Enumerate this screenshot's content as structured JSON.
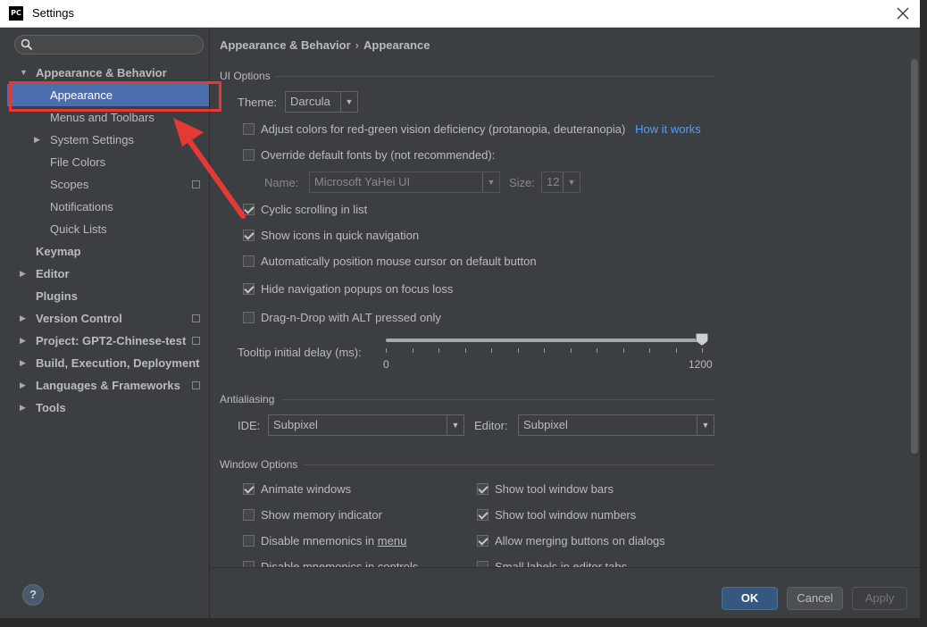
{
  "window": {
    "title": "Settings",
    "app_icon": "PC"
  },
  "search": {
    "placeholder": ""
  },
  "sidebar": {
    "items": [
      {
        "label": "Appearance & Behavior",
        "arrow": "▼"
      },
      {
        "label": "Appearance"
      },
      {
        "label": "Menus and Toolbars"
      },
      {
        "label": "System Settings",
        "arrow": "▶"
      },
      {
        "label": "File Colors"
      },
      {
        "label": "Scopes"
      },
      {
        "label": "Notifications"
      },
      {
        "label": "Quick Lists"
      },
      {
        "label": "Keymap"
      },
      {
        "label": "Editor",
        "arrow": "▶"
      },
      {
        "label": "Plugins"
      },
      {
        "label": "Version Control",
        "arrow": "▶"
      },
      {
        "label": "Project: GPT2-Chinese-test",
        "arrow": "▶"
      },
      {
        "label": "Build, Execution, Deployment",
        "arrow": "▶"
      },
      {
        "label": "Languages & Frameworks",
        "arrow": "▶"
      },
      {
        "label": "Tools",
        "arrow": "▶"
      }
    ],
    "help_label": "?"
  },
  "breadcrumb": {
    "parent": "Appearance & Behavior",
    "separator": "›",
    "current": "Appearance"
  },
  "ui_options": {
    "title": "UI Options",
    "theme_label": "Theme:",
    "theme_value": "Darcula",
    "adjust_colors": "Adjust colors for red-green vision deficiency (protanopia, deuteranopia)",
    "how_it_works": "How it works",
    "override_fonts": "Override default fonts by (not recommended):",
    "name_label": "Name:",
    "font_name": "Microsoft YaHei UI",
    "size_label": "Size:",
    "font_size": "12",
    "cyclic_scrolling": "Cyclic scrolling in list",
    "show_icons": "Show icons in quick navigation",
    "auto_position": "Automatically position mouse cursor on default button",
    "hide_popups": "Hide navigation popups on focus loss",
    "drag_drop": "Drag-n-Drop with ALT pressed only",
    "tooltip_label": "Tooltip initial delay (ms):",
    "tooltip_min": "0",
    "tooltip_max": "1200",
    "tooltip_value_fraction": 1.0
  },
  "antialiasing": {
    "title": "Antialiasing",
    "ide_label": "IDE:",
    "ide_value": "Subpixel",
    "editor_label": "Editor:",
    "editor_value": "Subpixel"
  },
  "window_options": {
    "title": "Window Options",
    "animate_windows": "Animate windows",
    "show_memory": "Show memory indicator",
    "disable_mnemonics_menu_prefix": "Disable mnemonics in ",
    "disable_mnemonics_menu_suffix": "menu",
    "disable_mnemonics_controls": "Disable mnemonics in controls",
    "show_tool_window_bars": "Show tool window bars",
    "show_tool_window_numbers": "Show tool window numbers",
    "allow_merging": "Allow merging buttons on dialogs",
    "small_labels": "Small labels in editor tabs"
  },
  "footer": {
    "ok": "OK",
    "cancel": "Cancel",
    "apply": "Apply"
  },
  "colors": {
    "selection": "#4b6eaf",
    "highlight": "#e53935",
    "link": "#589df6",
    "primary_button": "#365880"
  }
}
